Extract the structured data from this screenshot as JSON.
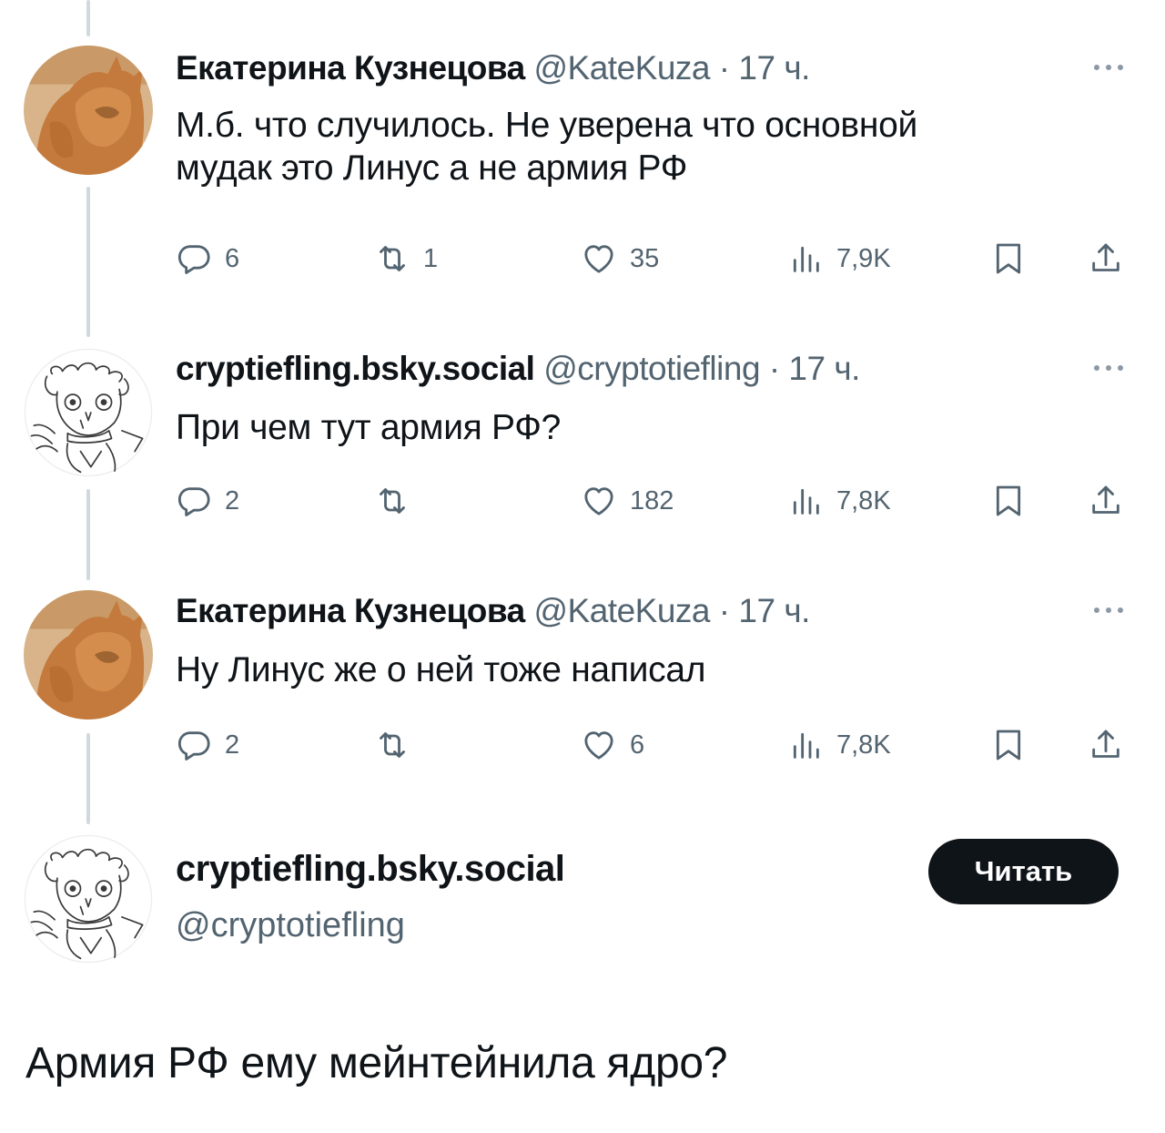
{
  "tweets": [
    {
      "author": "Екатерина Кузнецова",
      "handle": "@KateKuza",
      "time": "17 ч.",
      "text_lines": [
        "М.б. что случилось. Не уверена что основной",
        "мудак это Линус а не армия РФ"
      ],
      "replies": "6",
      "retweets": "1",
      "likes": "35",
      "views": "7,9K"
    },
    {
      "author": "cryptiefling.bsky.social",
      "handle": "@cryptotiefling",
      "time": "17 ч.",
      "text_lines": [
        "При чем тут армия РФ?"
      ],
      "replies": "2",
      "retweets": "",
      "likes": "182",
      "views": "7,8K"
    },
    {
      "author": "Екатерина Кузнецова",
      "handle": "@KateKuza",
      "time": "17 ч.",
      "text_lines": [
        "Ну Линус же о ней тоже написал"
      ],
      "replies": "2",
      "retweets": "",
      "likes": "6",
      "views": "7,8K"
    }
  ],
  "focused": {
    "author": "cryptiefling.bsky.social",
    "handle": "@cryptotiefling",
    "follow_label": "Читать",
    "text": "Армия РФ ему мейнтейнила ядро?"
  },
  "separator": "·",
  "icons": {
    "reply": "reply-icon",
    "retweet": "retweet-icon",
    "like": "heart-icon",
    "views": "views-icon",
    "bookmark": "bookmark-icon",
    "share": "share-icon",
    "more": "more-icon"
  },
  "colors": {
    "text": "#0f1419",
    "secondary": "#536471",
    "thread_line": "#cfd9de",
    "button_bg": "#0f1419"
  }
}
